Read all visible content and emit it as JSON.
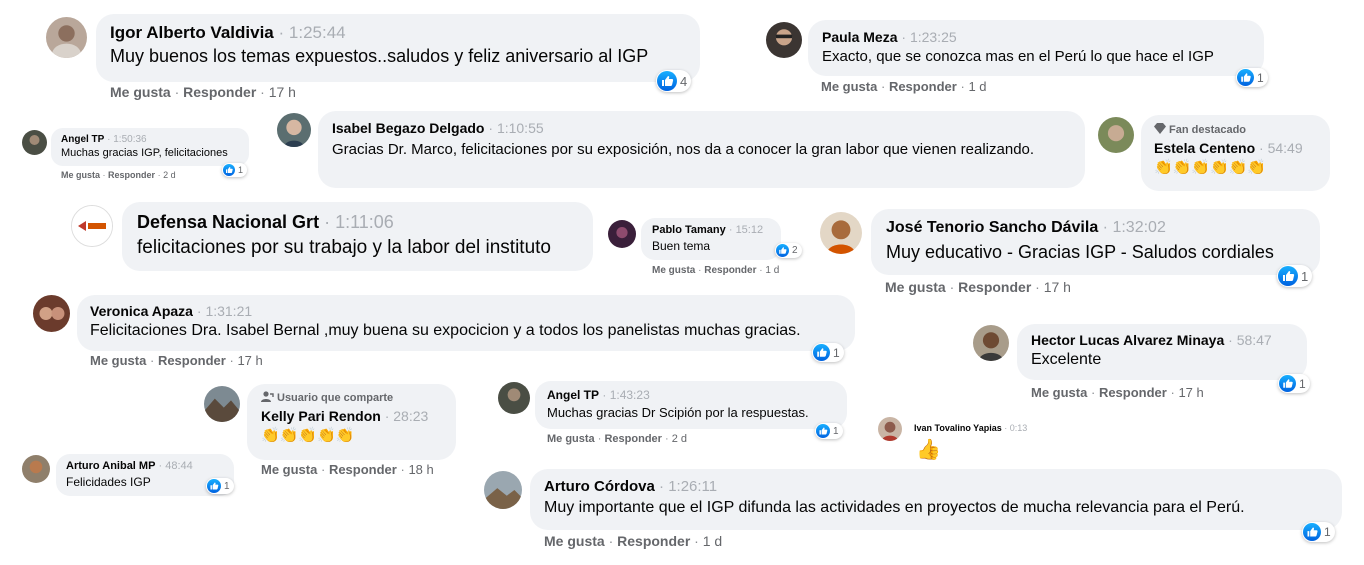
{
  "comments": {
    "igor": {
      "name": "Igor Alberto Valdivia",
      "time": "1:25:44",
      "text": "Muy buenos los temas expuestos..saludos y feliz aniversario al IGP",
      "like": "Me gusta",
      "reply": "Responder",
      "age": "17 h",
      "reactions": "4"
    },
    "paula": {
      "name": "Paula Meza",
      "time": "1:23:25",
      "text": "Exacto, que se conozca mas en el Perú lo que hace el IGP",
      "like": "Me gusta",
      "reply": "Responder",
      "age": "1 d",
      "reactions": "1"
    },
    "angel1": {
      "name": "Angel TP",
      "time": "1:50:36",
      "text": "Muchas gracias IGP, felicitaciones",
      "like": "Me gusta",
      "reply": "Responder",
      "age": "2 d",
      "reactions": "1"
    },
    "isabel": {
      "name": "Isabel Begazo Delgado",
      "time": "1:10:55",
      "text": "Gracias Dr. Marco, felicitaciones por su exposición, nos da a conocer la gran labor que vienen realizando."
    },
    "estela": {
      "badge": "Fan destacado",
      "name": "Estela Centeno",
      "time": "54:49",
      "emoji": "👏👏👏👏👏👏"
    },
    "defensa": {
      "name": "Defensa Nacional Grt",
      "time": "1:11:06",
      "text": "felicitaciones por su trabajo y la labor del instituto"
    },
    "pablo": {
      "name": "Pablo Tamany",
      "time": "15:12",
      "text": "Buen tema",
      "like": "Me gusta",
      "reply": "Responder",
      "age": "1 d",
      "reactions": "2"
    },
    "jose": {
      "name": "José Tenorio Sancho Dávila",
      "time": "1:32:02",
      "text": "Muy educativo - Gracias IGP - Saludos cordiales",
      "like": "Me gusta",
      "reply": "Responder",
      "age": "17 h",
      "reactions": "1"
    },
    "veronica": {
      "name": "Veronica Apaza",
      "time": "1:31:21",
      "text": "Felicitaciones Dra. Isabel Bernal ,muy buena su expocicion y a todos los panelistas muchas gracias.",
      "like": "Me gusta",
      "reply": "Responder",
      "age": "17 h",
      "reactions": "1"
    },
    "hector": {
      "name": "Hector Lucas Alvarez Minaya",
      "time": "58:47",
      "text": "Excelente",
      "like": "Me gusta",
      "reply": "Responder",
      "age": "17 h",
      "reactions": "1"
    },
    "kelly": {
      "badge": "Usuario que comparte",
      "name": "Kelly Pari Rendon",
      "time": "28:23",
      "emoji": "👏👏👏👏👏",
      "like": "Me gusta",
      "reply": "Responder",
      "age": "18 h"
    },
    "angel2": {
      "name": "Angel TP",
      "time": "1:43:23",
      "text": "Muchas gracias Dr Scipión por la respuestas.",
      "like": "Me gusta",
      "reply": "Responder",
      "age": "2 d",
      "reactions": "1"
    },
    "ivan": {
      "name": "Ivan Tovalino Yapias",
      "time": "0:13",
      "emoji": "👍"
    },
    "arturoa": {
      "name": "Arturo Anibal MP",
      "time": "48:44",
      "text": "Felicidades IGP",
      "reactions": "1"
    },
    "arturoc": {
      "name": "Arturo Córdova",
      "time": "1:26:11",
      "text": "Muy importante que el IGP difunda las actividades en proyectos de mucha relevancia para el Perú.",
      "like": "Me gusta",
      "reply": "Responder",
      "age": "1 d",
      "reactions": "1"
    }
  },
  "common": {
    "dot": "·"
  },
  "colors": {
    "bubble": "#f0f2f5",
    "name": "#050505",
    "meta": "#65676b",
    "timestamp": "#a9adb3",
    "like_blue": "#1877f2"
  },
  "icons": {
    "like": "like-thumb-icon",
    "fan": "diamond-icon",
    "sharer": "person-share-icon"
  }
}
